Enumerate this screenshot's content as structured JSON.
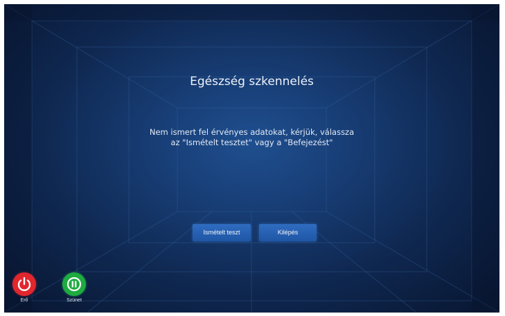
{
  "dialog": {
    "title": "Egészség szkennelés",
    "message_line1": "Nem ismert fel érvényes adatokat, kérjük, válassza",
    "message_line2": "az \"Ismételt tesztet\" vagy a \"Befejezést\""
  },
  "buttons": {
    "retest_label": "Ismételt teszt",
    "exit_label": "Kilépés"
  },
  "controls": {
    "power_label": "Erő",
    "pause_label": "Szünet",
    "power_color": "#e2262e",
    "pause_color": "#1eab3f"
  },
  "theme": {
    "background_color": "#173c73",
    "button_color": "#2a63b5"
  }
}
